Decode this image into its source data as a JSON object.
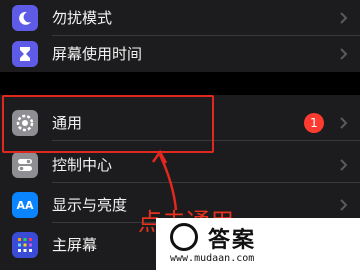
{
  "settings": {
    "group1": [
      {
        "label": "勿扰模式",
        "icon": "moon-icon"
      },
      {
        "label": "屏幕使用时间",
        "icon": "hourglass-icon"
      }
    ],
    "group2": [
      {
        "label": "通用",
        "icon": "gear-icon",
        "badge": "1"
      },
      {
        "label": "控制中心",
        "icon": "toggles-icon"
      },
      {
        "label": "显示与亮度",
        "icon": "text-size-icon",
        "icon_text": "AA"
      },
      {
        "label": "主屏幕",
        "icon": "app-grid-icon"
      }
    ]
  },
  "annotation": {
    "text": "点击通用",
    "color": "#e8321f"
  },
  "watermark": {
    "title": "答案",
    "url": "www.mudaan.com"
  },
  "colors": {
    "background": "#000000",
    "cell": "#1c1c1e",
    "badge": "#ff3b30",
    "highlight": "#e0281e"
  }
}
